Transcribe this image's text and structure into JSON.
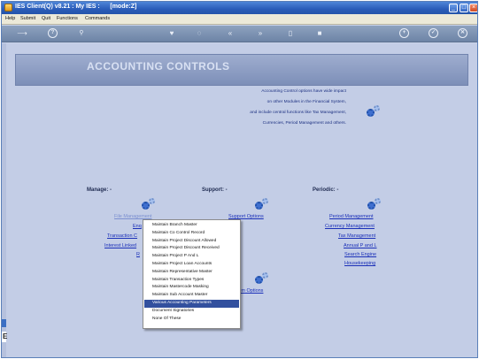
{
  "window": {
    "title": "IES Client(Q) v8.21 : My IES :      [mode:Z]"
  },
  "menubar": {
    "items": [
      "Help",
      "Submit",
      "Quit",
      "Functions",
      "Commands"
    ]
  },
  "toolbar": {
    "buttons": [
      {
        "icon": "exit-icon",
        "glyph": "⟶"
      },
      {
        "icon": "help-icon",
        "glyph": "?"
      },
      {
        "icon": "search-icon",
        "glyph": "🔍"
      },
      {
        "icon": "favorite-icon",
        "glyph": "♥"
      },
      {
        "icon": "history-icon",
        "glyph": "◌"
      },
      {
        "icon": "back-icon",
        "glyph": "«"
      },
      {
        "icon": "forward-icon",
        "glyph": "»"
      },
      {
        "icon": "bookmark-icon",
        "glyph": "▯"
      },
      {
        "icon": "stop-icon",
        "glyph": "■"
      },
      {
        "icon": "add-icon",
        "glyph": "+"
      },
      {
        "icon": "confirm-icon",
        "glyph": "✓"
      },
      {
        "icon": "cancel-icon",
        "glyph": "✕"
      }
    ]
  },
  "banner": {
    "title": "ACCOUNTING CONTROLS"
  },
  "info": {
    "lines": [
      "Accounting Control options have wide impact",
      "on other Modules in the Financial System,",
      "and include central functions like Tax Management,",
      "Currencies, Period Management and others."
    ]
  },
  "sections": {
    "manage": "Manage: -",
    "support": "Support: -",
    "periodic": "Periodic: -"
  },
  "manage_links": [
    "File Management",
    "Enq",
    "Transaction C",
    "Interest Linked",
    "R"
  ],
  "support_links": [
    "Support Options",
    "Custom Options"
  ],
  "periodic_links": [
    "Period Management",
    "Currency Management",
    "Tax Management",
    "Annual P and L",
    "Search Engine",
    "Housekeeping"
  ],
  "popup": {
    "items": [
      "Maintain Branch Master",
      "Maintain Co Control Record",
      "Maintain Project Discount Allowed",
      "Maintain Project Discount Received",
      "Maintain Project P And L",
      "Maintain Project Loan Accounts",
      "Maintain Representative Master",
      "Maintain Transaction Types",
      "Maintain Mastercode Masking",
      "Maintain Sub Account Master",
      "Various Accounting Parameters",
      "Document Signatories",
      "None Of These"
    ],
    "selected_index": 10
  },
  "colors": {
    "title_bar": "#2a5cb8",
    "background": "#c3cde6",
    "link": "#1a2fb8",
    "selection": "#32509e"
  }
}
